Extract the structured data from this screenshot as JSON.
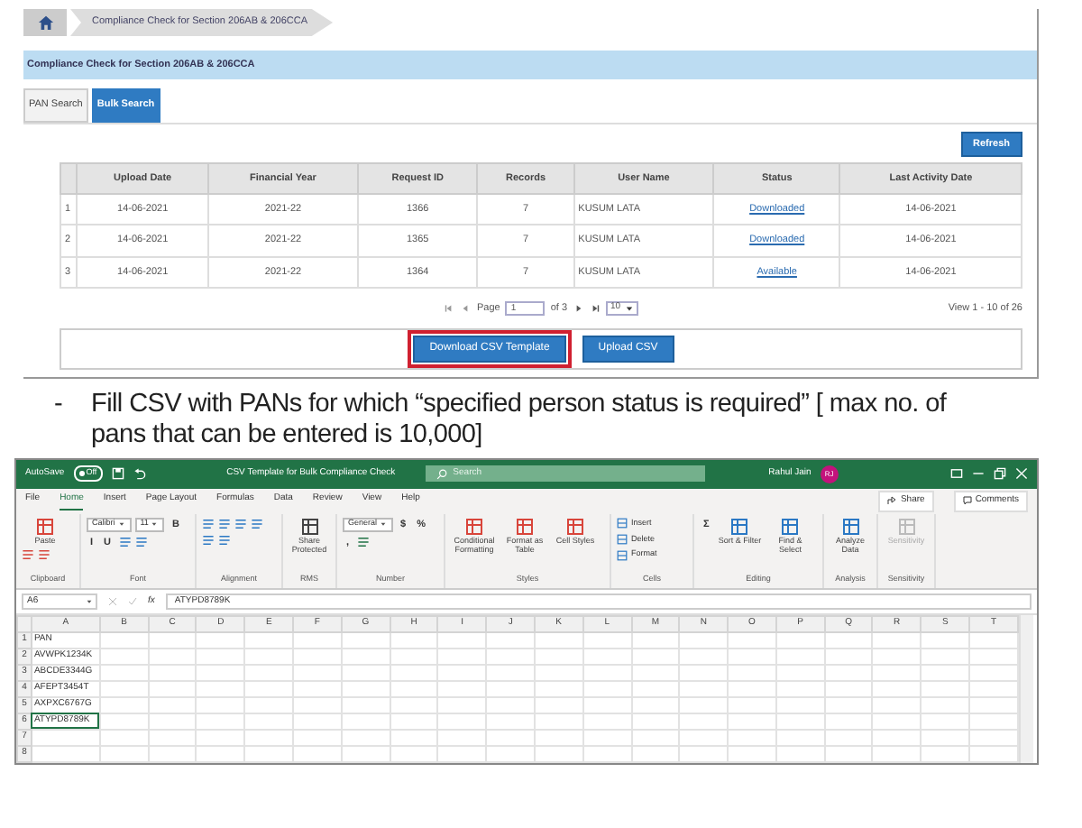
{
  "portal": {
    "breadcrumb": "Compliance Check for Section 206AB & 206CCA",
    "panel_title": "Compliance Check for Section 206AB & 206CCA",
    "tabs": [
      {
        "label": "PAN Search",
        "selected": false
      },
      {
        "label": "Bulk Search",
        "selected": true
      }
    ],
    "refresh_button": "Refresh",
    "table": {
      "columns": [
        {
          "kind": "index"
        },
        {
          "label": "Upload Date",
          "kind": "text"
        },
        {
          "label": "Financial Year",
          "kind": "text"
        },
        {
          "label": "Request ID",
          "kind": "text"
        },
        {
          "label": "Records",
          "kind": "text"
        },
        {
          "label": "User Name",
          "kind": "left"
        },
        {
          "label": "Status",
          "kind": "link"
        },
        {
          "label": "Last Activity Date",
          "kind": "text"
        }
      ],
      "rows": [
        [
          "1",
          "14-06-2021",
          "2021-22",
          "1366",
          "7",
          "KUSUM LATA",
          "Downloaded",
          "14-06-2021"
        ],
        [
          "2",
          "14-06-2021",
          "2021-22",
          "1365",
          "7",
          "KUSUM LATA",
          "Downloaded",
          "14-06-2021"
        ],
        [
          "3",
          "14-06-2021",
          "2021-22",
          "1364",
          "7",
          "KUSUM LATA",
          "Available",
          "14-06-2021"
        ]
      ]
    },
    "pager": {
      "page_label": "Page",
      "page": "1",
      "of": "of 3",
      "per_page": "10",
      "view": "View 1 - 10 of 26"
    },
    "actions": [
      {
        "label": "Download CSV Template",
        "highlighted": true
      },
      {
        "label": "Upload CSV",
        "highlighted": false
      }
    ]
  },
  "bullet": {
    "marker": "-",
    "text": "Fill CSV with PANs for which “specified person status is required” [ max no. of pans that can be entered is 10,000]"
  },
  "excel": {
    "autosave": "AutoSave",
    "autosave_toggle": {
      "label": "Off",
      "on": false
    },
    "title": "CSV Template for Bulk Compliance Check",
    "search_placeholder": "Search",
    "user": "Rahul Jain",
    "avatar": "RJ",
    "menu": [
      {
        "label": "File",
        "selected": false
      },
      {
        "label": "Home",
        "selected": true
      },
      {
        "label": "Insert",
        "selected": false
      },
      {
        "label": "Page Layout",
        "selected": false
      },
      {
        "label": "Formulas",
        "selected": false
      },
      {
        "label": "Data",
        "selected": false
      },
      {
        "label": "Review",
        "selected": false
      },
      {
        "label": "View",
        "selected": false
      },
      {
        "label": "Help",
        "selected": false
      }
    ],
    "share": "Share",
    "comments": "Comments",
    "ribbon": [
      {
        "name": "Clipboard",
        "tools": [
          {
            "kind": "big",
            "label": "Paste"
          },
          {
            "kind": "icon"
          },
          {
            "kind": "icon"
          }
        ]
      },
      {
        "name": "Font",
        "tools": [
          {
            "kind": "field",
            "label": "Calibri"
          },
          {
            "kind": "field",
            "label": "11"
          },
          {
            "kind": "glyph",
            "label": "B"
          },
          {
            "kind": "glyph",
            "label": "I"
          },
          {
            "kind": "glyph",
            "label": "U"
          },
          {
            "kind": "icon"
          },
          {
            "kind": "icon"
          }
        ]
      },
      {
        "name": "Alignment",
        "tools": [
          {
            "kind": "icon"
          },
          {
            "kind": "icon"
          },
          {
            "kind": "icon"
          },
          {
            "kind": "icon"
          },
          {
            "kind": "icon"
          },
          {
            "kind": "icon"
          }
        ]
      },
      {
        "name": "RMS",
        "tools": [
          {
            "kind": "big",
            "label": "Share Protected"
          }
        ]
      },
      {
        "name": "Number",
        "tools": [
          {
            "kind": "field",
            "label": "General"
          },
          {
            "kind": "glyph",
            "label": "$"
          },
          {
            "kind": "glyph",
            "label": "%"
          },
          {
            "kind": "glyph",
            "label": ","
          },
          {
            "kind": "icon"
          }
        ]
      },
      {
        "name": "Styles",
        "tools": [
          {
            "kind": "big",
            "label": "Conditional Formatting"
          },
          {
            "kind": "big",
            "label": "Format as Table"
          },
          {
            "kind": "big",
            "label": "Cell Styles"
          }
        ]
      },
      {
        "name": "Cells",
        "tools": [
          {
            "kind": "small",
            "label": "Insert"
          },
          {
            "kind": "small",
            "label": "Delete"
          },
          {
            "kind": "small",
            "label": "Format"
          }
        ]
      },
      {
        "name": "Editing",
        "tools": [
          {
            "kind": "glyph",
            "label": "Σ"
          },
          {
            "kind": "big",
            "label": "Sort & Filter"
          },
          {
            "kind": "big",
            "label": "Find & Select"
          }
        ]
      },
      {
        "name": "Analysis",
        "tools": [
          {
            "kind": "big",
            "label": "Analyze Data"
          }
        ]
      },
      {
        "name": "Sensitivity",
        "tools": [
          {
            "kind": "big",
            "label": "Sensitivity",
            "disabled": true
          }
        ]
      }
    ],
    "name_box": "A6",
    "function_label": "fx",
    "formula": "ATYPD8789K",
    "columns": [
      "A",
      "B",
      "C",
      "D",
      "E",
      "F",
      "G",
      "H",
      "I",
      "J",
      "K",
      "L",
      "M",
      "N",
      "O",
      "P",
      "Q",
      "R",
      "S",
      "T"
    ],
    "rows": [
      {
        "number": "1",
        "value": "PAN",
        "selected": false
      },
      {
        "number": "2",
        "value": "AVWPK1234K",
        "selected": false
      },
      {
        "number": "3",
        "value": "ABCDE3344G",
        "selected": false
      },
      {
        "number": "4",
        "value": "AFEPT3454T",
        "selected": false
      },
      {
        "number": "5",
        "value": "AXPXC6767G",
        "selected": false
      },
      {
        "number": "6",
        "value": "ATYPD8789K",
        "selected": true
      },
      {
        "number": "7",
        "selected": false
      },
      {
        "number": "8",
        "selected": false
      }
    ]
  }
}
